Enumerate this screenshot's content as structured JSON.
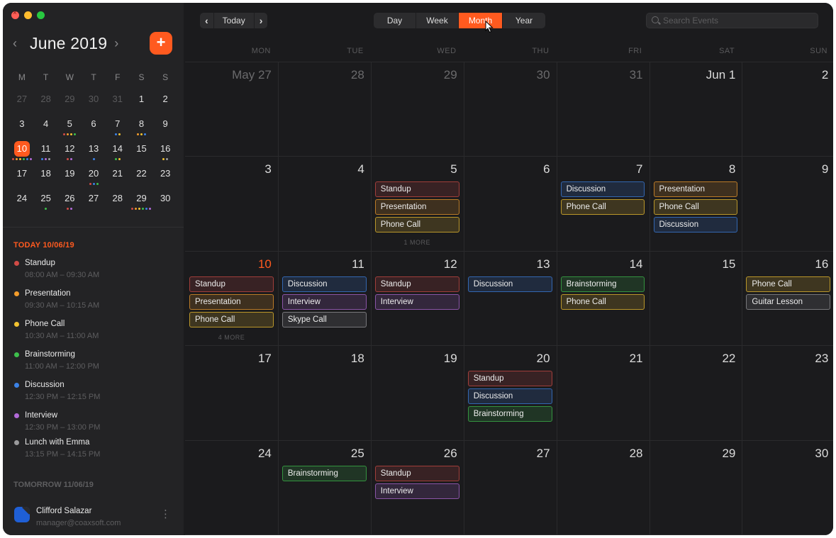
{
  "colors": {
    "accent": "#ff5a1f",
    "standup": "#d14b46",
    "presentation": "#f39c2b",
    "phone_call": "#f2c230",
    "brainstorming": "#3dbf4c",
    "discussion": "#3b82e6",
    "interview": "#b26ad9",
    "neutral": "#9a9a9c"
  },
  "sidebar": {
    "mini_calendar": {
      "title": "June 2019",
      "prev_icon": "chevron-left-icon",
      "next_icon": "chevron-right-icon",
      "add_label": "+",
      "weekdays": [
        "M",
        "T",
        "W",
        "T",
        "F",
        "S",
        "S"
      ],
      "weeks": [
        [
          {
            "d": "27",
            "m": true
          },
          {
            "d": "28",
            "m": true
          },
          {
            "d": "29",
            "m": true
          },
          {
            "d": "30",
            "m": true
          },
          {
            "d": "31",
            "m": true
          },
          {
            "d": "1"
          },
          {
            "d": "2"
          }
        ],
        [
          {
            "d": "3"
          },
          {
            "d": "4"
          },
          {
            "d": "5",
            "dots": [
              "standup",
              "presentation",
              "phone_call",
              "brainstorming"
            ]
          },
          {
            "d": "6"
          },
          {
            "d": "7",
            "dots": [
              "discussion",
              "phone_call"
            ]
          },
          {
            "d": "8",
            "dots": [
              "presentation",
              "phone_call",
              "discussion"
            ]
          },
          {
            "d": "9"
          }
        ],
        [
          {
            "d": "10",
            "today": true,
            "dots": [
              "standup",
              "presentation",
              "phone_call",
              "brainstorming",
              "discussion",
              "interview"
            ]
          },
          {
            "d": "11",
            "dots": [
              "discussion",
              "interview",
              "neutral"
            ]
          },
          {
            "d": "12",
            "dots": [
              "standup",
              "interview"
            ]
          },
          {
            "d": "13",
            "dots": [
              "discussion"
            ]
          },
          {
            "d": "14",
            "dots": [
              "brainstorming",
              "phone_call"
            ]
          },
          {
            "d": "15"
          },
          {
            "d": "16",
            "dots": [
              "phone_call",
              "neutral"
            ]
          }
        ],
        [
          {
            "d": "17"
          },
          {
            "d": "18"
          },
          {
            "d": "19"
          },
          {
            "d": "20",
            "dots": [
              "standup",
              "discussion",
              "brainstorming"
            ]
          },
          {
            "d": "21"
          },
          {
            "d": "22"
          },
          {
            "d": "23"
          }
        ],
        [
          {
            "d": "24"
          },
          {
            "d": "25",
            "dots": [
              "brainstorming"
            ]
          },
          {
            "d": "26",
            "dots": [
              "standup",
              "interview"
            ]
          },
          {
            "d": "27"
          },
          {
            "d": "28"
          },
          {
            "d": "29",
            "dots": [
              "standup",
              "presentation",
              "phone_call",
              "brainstorming",
              "discussion",
              "interview"
            ]
          },
          {
            "d": "30"
          }
        ]
      ]
    },
    "agenda": {
      "today_label": "TODAY 10/06/19",
      "items": [
        {
          "title": "Standup",
          "time": "08:00 AM – 09:30 AM",
          "color": "standup"
        },
        {
          "title": "Presentation",
          "time": "09:30 AM – 10:15 AM",
          "color": "presentation"
        },
        {
          "title": "Phone Call",
          "time": "10:30 AM – 11:00 AM",
          "color": "phone_call"
        },
        {
          "title": "Brainstorming",
          "time": "11:00 AM – 12:00 PM",
          "color": "brainstorming"
        },
        {
          "title": "Discussion",
          "time": "12:30 PM – 12:15 PM",
          "color": "discussion"
        },
        {
          "title": "Interview",
          "time": "12:30 PM – 13:00 PM",
          "color": "interview"
        },
        {
          "title": "Lunch with Emma",
          "time": "13:15 PM – 14:15 PM",
          "color": "neutral"
        }
      ],
      "tomorrow_label": "TOMORROW 11/06/19"
    },
    "profile": {
      "name": "Clifford Salazar",
      "email": "manager@coaxsoft.com",
      "more_icon": "vertical-ellipsis-icon"
    }
  },
  "toolbar": {
    "prev_label": "‹",
    "today_label": "Today",
    "next_label": "›",
    "views": [
      "Day",
      "Week",
      "Month",
      "Year"
    ],
    "active_view": "Month",
    "search_placeholder": "Search Events"
  },
  "month": {
    "weekdays": [
      "MON",
      "TUE",
      "WED",
      "THU",
      "FRI",
      "SAT",
      "SUN"
    ],
    "weeks": [
      [
        {
          "label": "May 27",
          "other": true
        },
        {
          "label": "28",
          "other": true
        },
        {
          "label": "29",
          "other": true
        },
        {
          "label": "30",
          "other": true
        },
        {
          "label": "31",
          "other": true
        },
        {
          "label": "Jun 1"
        },
        {
          "label": "2"
        }
      ],
      [
        {
          "label": "3"
        },
        {
          "label": "4"
        },
        {
          "label": "5",
          "events": [
            [
              "Standup",
              "standup"
            ],
            [
              "Presentation",
              "presentation"
            ],
            [
              "Phone Call",
              "phone_call"
            ]
          ],
          "more": "1 MORE"
        },
        {
          "label": "6"
        },
        {
          "label": "7",
          "events": [
            [
              "Discussion",
              "discussion"
            ],
            [
              "Phone Call",
              "phone_call"
            ]
          ]
        },
        {
          "label": "8",
          "events": [
            [
              "Presentation",
              "presentation"
            ],
            [
              "Phone Call",
              "phone_call"
            ],
            [
              "Discussion",
              "discussion"
            ]
          ]
        },
        {
          "label": "9"
        }
      ],
      [
        {
          "label": "10",
          "today": true,
          "events": [
            [
              "Standup",
              "standup"
            ],
            [
              "Presentation",
              "presentation"
            ],
            [
              "Phone Call",
              "phone_call"
            ]
          ],
          "more": "4 MORE"
        },
        {
          "label": "11",
          "events": [
            [
              "Discussion",
              "discussion"
            ],
            [
              "Interview",
              "interview"
            ],
            [
              "Skype Call",
              "neutral"
            ]
          ]
        },
        {
          "label": "12",
          "events": [
            [
              "Standup",
              "standup"
            ],
            [
              "Interview",
              "interview"
            ]
          ]
        },
        {
          "label": "13",
          "events": [
            [
              "Discussion",
              "discussion"
            ]
          ]
        },
        {
          "label": "14",
          "events": [
            [
              "Brainstorming",
              "brainstorming"
            ],
            [
              "Phone Call",
              "phone_call"
            ]
          ]
        },
        {
          "label": "15"
        },
        {
          "label": "16",
          "events": [
            [
              "Phone Call",
              "phone_call"
            ],
            [
              "Guitar Lesson",
              "neutral"
            ]
          ]
        }
      ],
      [
        {
          "label": "17"
        },
        {
          "label": "18"
        },
        {
          "label": "19"
        },
        {
          "label": "20",
          "events": [
            [
              "Standup",
              "standup"
            ],
            [
              "Discussion",
              "discussion"
            ],
            [
              "Brainstorming",
              "brainstorming"
            ]
          ]
        },
        {
          "label": "21"
        },
        {
          "label": "22"
        },
        {
          "label": "23"
        }
      ],
      [
        {
          "label": "24"
        },
        {
          "label": "25",
          "events": [
            [
              "Brainstorming",
              "brainstorming"
            ]
          ]
        },
        {
          "label": "26",
          "events": [
            [
              "Standup",
              "standup"
            ],
            [
              "Interview",
              "interview"
            ]
          ]
        },
        {
          "label": "27"
        },
        {
          "label": "28"
        },
        {
          "label": "29"
        },
        {
          "label": "30"
        }
      ]
    ]
  }
}
